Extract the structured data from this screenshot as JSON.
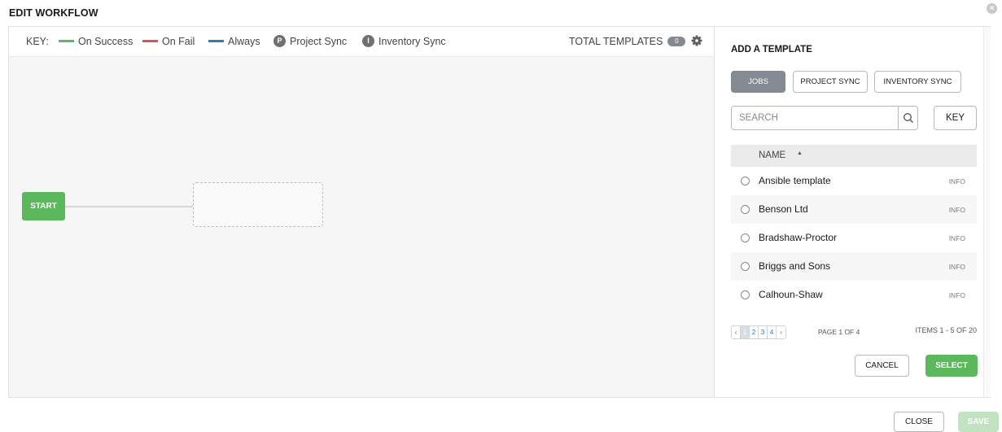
{
  "modal": {
    "title": "EDIT WORKFLOW"
  },
  "key": {
    "label": "KEY:",
    "items": [
      {
        "label": "On Success",
        "color": "#5cb85c"
      },
      {
        "label": "On Fail",
        "color": "#d9534f"
      },
      {
        "label": "Always",
        "color": "#337ab7"
      }
    ],
    "project_sync": {
      "letter": "P",
      "label": "Project Sync"
    },
    "inventory_sync": {
      "letter": "I",
      "label": "Inventory Sync"
    },
    "total_templates_label": "TOTAL TEMPLATES",
    "total_templates_count": "0"
  },
  "canvas": {
    "start_label": "START"
  },
  "panel": {
    "title": "ADD A TEMPLATE",
    "tabs": [
      {
        "label": "JOBS",
        "active": true
      },
      {
        "label": "PROJECT SYNC",
        "active": false
      },
      {
        "label": "INVENTORY SYNC",
        "active": false
      }
    ],
    "search_placeholder": "SEARCH",
    "key_button": "KEY",
    "column_name": "NAME",
    "rows": [
      {
        "name": "Ansible template",
        "info": "INFO"
      },
      {
        "name": "Benson Ltd",
        "info": "INFO"
      },
      {
        "name": "Bradshaw-Proctor",
        "info": "INFO"
      },
      {
        "name": "Briggs and Sons",
        "info": "INFO"
      },
      {
        "name": "Calhoun-Shaw",
        "info": "INFO"
      }
    ],
    "pagination": {
      "prev": "‹",
      "pages": [
        "1",
        "2",
        "3",
        "4"
      ],
      "next": "›",
      "page_info": "PAGE 1 OF 4",
      "items_info": "ITEMS  1 - 5 OF 20"
    },
    "cancel_label": "CANCEL",
    "select_label": "SELECT"
  },
  "footer": {
    "close_label": "CLOSE",
    "save_label": "SAVE"
  },
  "colors": {
    "accent_green": "#5cb85c",
    "active_tab": "#848992"
  }
}
